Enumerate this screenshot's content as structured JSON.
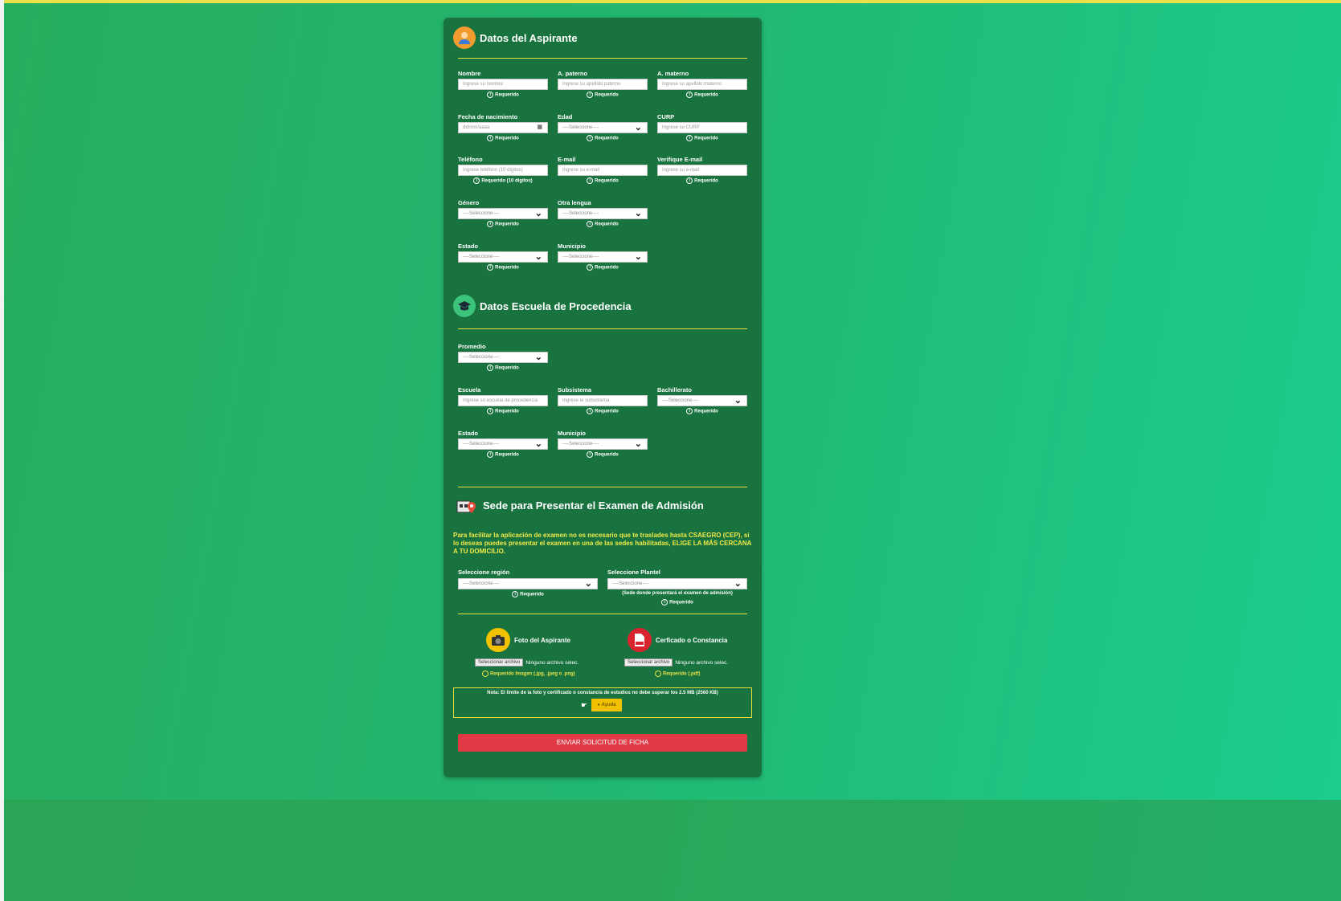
{
  "colors": {
    "card": "#18733f",
    "accent_line": "#e6dc3c",
    "submit": "#e03a46",
    "notice_text": "#f2e94a"
  },
  "section1": {
    "title": "Datos del Aspirante",
    "icon": "person-icon",
    "fields": [
      {
        "label": "Nombre",
        "placeholder": "Ingrese su nombre",
        "req": "Requerido"
      },
      {
        "label": "A. paterno",
        "placeholder": "Ingrese su apellido paterno",
        "req": "Requerido"
      },
      {
        "label": "A. materno",
        "placeholder": "Ingrese su apellido materno",
        "req": "Requerido"
      },
      {
        "label": "Fecha de nacimiento",
        "placeholder": "dd/mm/aaaa",
        "req": "Requerido"
      },
      {
        "label": "Edad",
        "placeholder": "----Seleccione----",
        "req": "Requerido"
      },
      {
        "label": "CURP",
        "placeholder": "Ingrese su CURP",
        "req": "Requerido"
      },
      {
        "label": "Teléfono",
        "placeholder": "Ingrese teléfono (10 dígitos)",
        "req": "Requerido (10 dígitos)"
      },
      {
        "label": "E-mail",
        "placeholder": "Ingrese su e-mail",
        "req": "Requerido"
      },
      {
        "label": "Verifique E-mail",
        "placeholder": "Ingrese su e-mail",
        "req": "Requerido"
      },
      {
        "label": "Género",
        "placeholder": "----Seleccione----",
        "req": "Requerido"
      },
      {
        "label": "Otra lengua",
        "placeholder": "----Seleccione----",
        "req": "Requerido"
      },
      {
        "label": "Estado",
        "placeholder": "----Seleccione----",
        "req": "Requerido"
      },
      {
        "label": "Municipio",
        "placeholder": "----Seleccione----",
        "req": "Requerido"
      }
    ]
  },
  "section2": {
    "title": "Datos Escuela de Procedencia",
    "icon": "graduation-cap-icon",
    "fields": [
      {
        "label": "Promedio",
        "placeholder": "----Seleccione----",
        "req": "Requerido"
      },
      {
        "label": "Escuela",
        "placeholder": "Ingrese su escuela de procedencia",
        "req": "Requerido"
      },
      {
        "label": "Subsistema",
        "placeholder": "Ingrese el subsistema",
        "req": "Requerido"
      },
      {
        "label": "Bachillerato",
        "placeholder": "----Seleccione----",
        "req": "Requerido"
      },
      {
        "label": "Estado",
        "placeholder": "----Seleccione----",
        "req": "Requerido"
      },
      {
        "label": "Municipio",
        "placeholder": "----Seleccione----",
        "req": "Requerido"
      }
    ]
  },
  "section3": {
    "title": "Sede para Presentar el Examen de Admisión",
    "icon": "location-pin-icon",
    "notice": "Para facilitar la aplicación de examen no es necesario que te traslades hasta CSAEGRO (CEP), si lo deseas puedes presentar el examen en una de las sedes habilitadas, ELIGE LA MÁS CERCANA A TU DOMICILIO.",
    "region_label": "Seleccione región",
    "region_placeholder": "----Seleccione----",
    "region_req": "Requerido",
    "plantel_label": "Seleccione Plantel",
    "plantel_placeholder": "----Seleccione----",
    "plantel_hint": "(Sede donde presentará el examen de admisión)",
    "plantel_req": "Requerido"
  },
  "uploads": {
    "photo_title": "Foto del Aspirante",
    "photo_icon": "camera-icon",
    "cert_title": "Cerficado o Constancia",
    "cert_icon": "pdf-icon",
    "file_button": "Seleccionar archivo",
    "no_file": "Ninguno archivo selec.",
    "photo_req": "Requerido Imagen (.jpg, .jpeg o .png)",
    "cert_req": "Requerido (.pdf)"
  },
  "note": {
    "text": "Nota: El límite de la foto y certificado o constancia de estudios no debe superar los 2.5 MB (2560 KB)",
    "help": "Ayuda"
  },
  "submit_label": "ENVIAR SOLICITUD DE FICHA"
}
